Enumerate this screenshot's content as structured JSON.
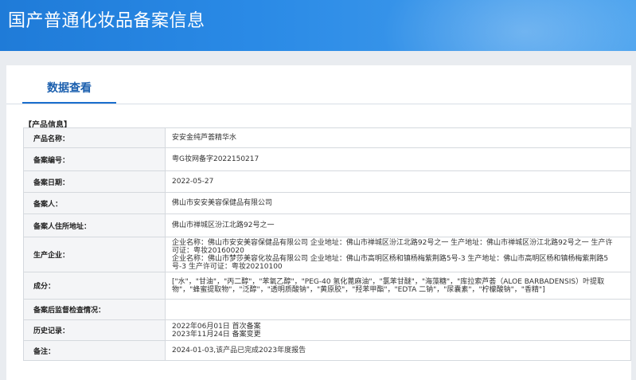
{
  "header": {
    "title": "国产普通化妆品备案信息"
  },
  "tabs": [
    {
      "label": "数据查看"
    }
  ],
  "section": {
    "title": "【产品信息】"
  },
  "rows": [
    {
      "label": "产品名称：",
      "lines": [
        "安安金纯芦荟精华水"
      ]
    },
    {
      "label": "备案编号：",
      "lines": [
        "粤G妆网备字2022150217"
      ]
    },
    {
      "label": "备案日期：",
      "lines": [
        "2022-05-27"
      ]
    },
    {
      "label": "备案人：",
      "lines": [
        "佛山市安安美容保健品有限公司"
      ]
    },
    {
      "label": "备案人住所地址：",
      "lines": [
        "佛山市禅城区汾江北路92号之一"
      ]
    },
    {
      "label": "生产企业：",
      "lines": [
        "企业名称：佛山市安安美容保健品有限公司 企业地址：佛山市禅城区汾江北路92号之一 生产地址：佛山市禅城区汾江北路92号之一 生产许",
        "可证：粤妆20160020",
        "企业名称：佛山市梦莎美容化妆品有限公司 企业地址：佛山市高明区杨和镇杨梅紫荆路5号-3 生产地址：佛山市高明区杨和镇杨梅紫荆路5",
        "号-3 生产许可证：粤妆20210100"
      ]
    },
    {
      "label": "成分：",
      "lines": [
        "[\"水\"，\"甘油\"，\"丙二醇\"，\"苯氧乙醇\"，\"PEG-40 氢化蓖麻油\"，\"氯苯甘醚\"，\"海藻糖\"，\"库拉索芦荟（ALOE BARBADENSIS）叶提取",
        "物\"，\"蜂蜜提取物\"，\"泛醇\"，\"透明质酸钠\"，\"黄原胶\"，\"羟苯甲酯\"，\"EDTA 二钠\"，\"尿囊素\"，\"柠檬酸钠\"，\"香精\"]"
      ]
    },
    {
      "label": "备案后监督检查情况：",
      "lines": [
        ""
      ]
    },
    {
      "label": "历史记录：",
      "lines": [
        "2022年06月01日 首次备案",
        "2023年11月24日 备案变更"
      ]
    },
    {
      "label": "备注：",
      "lines": [
        "2024-01-03,该产品已完成2023年度报告"
      ]
    }
  ]
}
